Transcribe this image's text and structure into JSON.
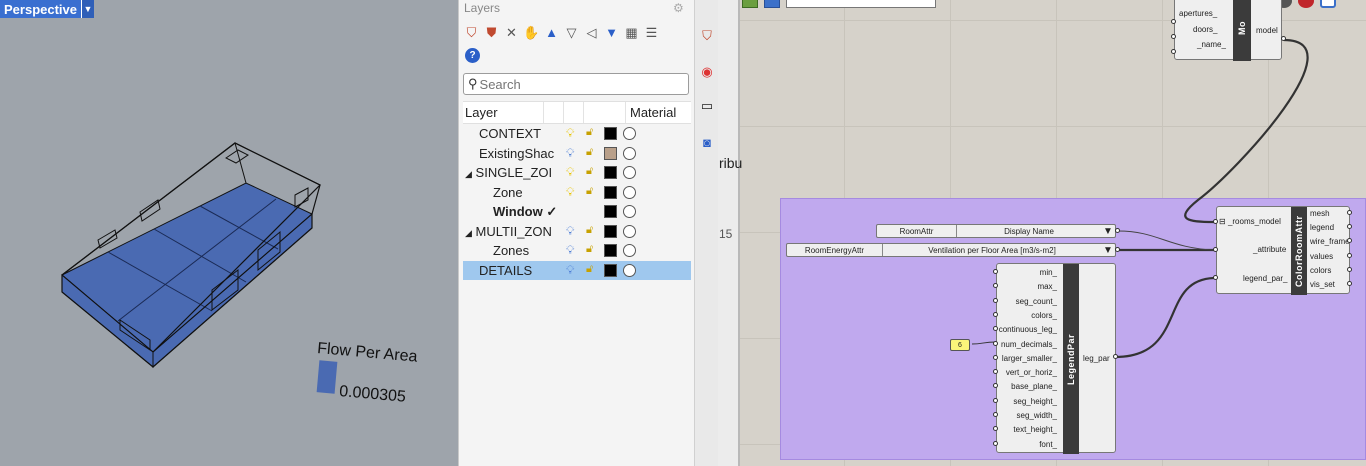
{
  "viewport": {
    "tab_label": "Perspective",
    "legend_title": "Flow Per Area",
    "legend_value": "0.000305",
    "colors": {
      "background": "#9ea4ab",
      "room_fill": "#4a6ab2",
      "legend_swatch": "#4a6ab2"
    }
  },
  "layers_panel": {
    "title": "Layers",
    "search_placeholder": "Search",
    "columns": {
      "layer": "Layer",
      "material": "Material"
    },
    "rows": [
      {
        "name": "CONTEXT",
        "indent": 1,
        "bulb": "on",
        "lock": "unlocked",
        "color": "#000000"
      },
      {
        "name": "ExistingShac",
        "indent": 1,
        "bulb": "off",
        "lock": "unlocked",
        "color": "#b9a08a"
      },
      {
        "name": "SINGLE_ZOI",
        "indent": 0,
        "expanded": true,
        "bulb": "on",
        "lock": "unlocked",
        "color": "#000000"
      },
      {
        "name": "Zone",
        "indent": 2,
        "bulb": "on",
        "lock": "unlocked",
        "color": "#000000"
      },
      {
        "name": "Window",
        "indent": 2,
        "current": true,
        "color": "#000000"
      },
      {
        "name": "MULTII_ZON",
        "indent": 0,
        "expanded": true,
        "bulb": "off",
        "lock": "unlocked",
        "color": "#000000"
      },
      {
        "name": "Zones",
        "indent": 2,
        "bulb": "off",
        "lock": "unlocked",
        "color": "#000000"
      },
      {
        "name": "DETAILS",
        "indent": 1,
        "selected": true,
        "bulb": "off",
        "lock": "unlocked",
        "color": "#000000"
      }
    ]
  },
  "gh_canvas": {
    "partial_text": "ribu",
    "partial_text2": "15",
    "group_color": "#c0a9ee",
    "model_component": {
      "inputs": [
        "apertures_",
        "doors_",
        "_name_"
      ],
      "output": "model",
      "nickname": "Mo"
    },
    "value_lists": [
      {
        "name": "RoomAttr",
        "value": "Display Name"
      },
      {
        "name": "RoomEnergyAttr",
        "value": "Ventilation per Floor Area [m3/s-m2]"
      }
    ],
    "color_room_attr": {
      "nickname": "ColorRoomAttr",
      "inputs": [
        "_rooms_model",
        "_attribute",
        "legend_par_"
      ],
      "outputs": [
        "mesh",
        "legend",
        "wire_frame",
        "values",
        "colors",
        "vis_set"
      ]
    },
    "legend_par": {
      "nickname": "LegendPar",
      "inputs": [
        "min_",
        "max_",
        "seg_count_",
        "colors_",
        "continuous_leg_",
        "num_decimals_",
        "larger_smaller_",
        "vert_or_horiz_",
        "base_plane_",
        "seg_height_",
        "seg_width_",
        "text_height_",
        "font_"
      ],
      "output": "leg_par"
    },
    "number_panel": "6"
  }
}
